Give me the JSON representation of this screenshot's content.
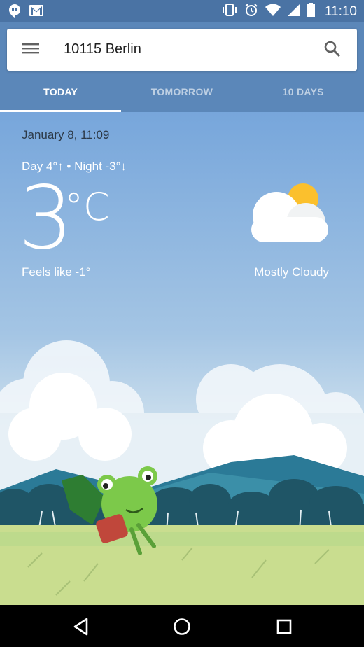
{
  "status": {
    "time": "11:10",
    "icons_left": [
      "hangouts-icon",
      "gmail-icon"
    ],
    "icons_right": [
      "vibrate-icon",
      "alarm-icon",
      "wifi-icon",
      "signal-icon",
      "battery-icon"
    ]
  },
  "search": {
    "location": "10115 Berlin"
  },
  "tabs": [
    {
      "label": "TODAY"
    },
    {
      "label": "TOMORROW"
    },
    {
      "label": "10 DAYS"
    }
  ],
  "weather": {
    "date": "January 8, 11:09",
    "day_night": "Day 4°↑ • Night -3°↓",
    "temperature": "3",
    "unit": "°C",
    "feels_like": "Feels like -1°",
    "condition": "Mostly Cloudy"
  },
  "colors": {
    "statusbar": "#4a73a4",
    "tabs_bg": "#5b87b9",
    "sky_top": "#77a6db"
  }
}
